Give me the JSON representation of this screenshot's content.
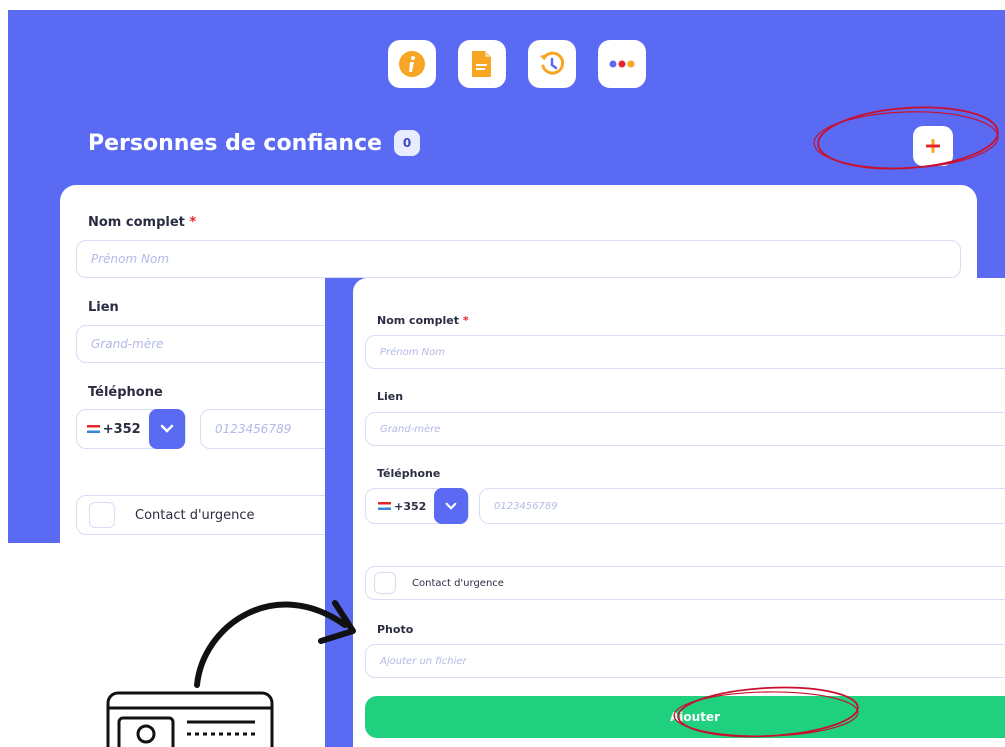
{
  "top_icons": [
    {
      "name": "info-icon",
      "color": "#f6a623"
    },
    {
      "name": "document-icon",
      "color": "#f6a623"
    },
    {
      "name": "history-icon",
      "color": "#f6a623"
    },
    {
      "name": "more-icon",
      "color": "#5b6af3"
    }
  ],
  "header": {
    "title": "Personnes de confiance",
    "count": "0",
    "add_icon": "plus-icon"
  },
  "form": {
    "name_label": "Nom complet",
    "required_mark": "*",
    "name_placeholder": "Prénom Nom",
    "link_label": "Lien",
    "link_placeholder": "Grand-mère",
    "phone_label": "Téléphone",
    "phone_prefix": "+352",
    "phone_placeholder": "0123456789",
    "emergency_label": "Contact d'urgence",
    "photo_label": "Photo",
    "photo_placeholder": "Ajouter un fichier",
    "submit_label": "Ajouter"
  },
  "colors": {
    "brand_blue": "#5b6af3",
    "accent_orange": "#f6a623",
    "submit_green": "#1fd17e",
    "highlight_red": "#c8102e"
  }
}
